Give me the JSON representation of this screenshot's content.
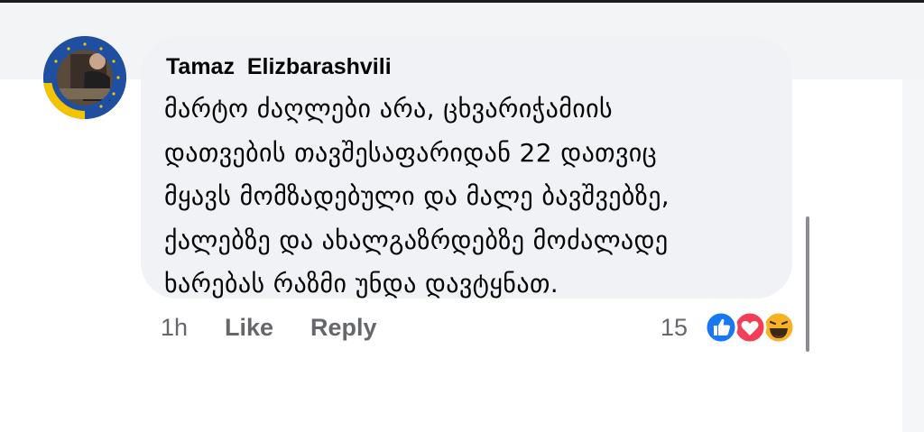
{
  "comment": {
    "author": "Tamaz  Elizbarashvili",
    "lines": [
      "მარტო ძაღლები არა, ცხვარიჭამიის",
      "დათვების თავშესაფარიდან 22 დათვიც",
      "მყავს მომზადებული და მალე ბავშვებზე,",
      "ქალებზე და ახალგაზრდებზე მოძალადე",
      "ხარებას რაზმი უნდა დავტყნათ."
    ],
    "time": "1h",
    "like_label": "Like",
    "reply_label": "Reply",
    "reaction_count": "15",
    "reactions": [
      "like-icon",
      "love-icon",
      "haha-icon"
    ]
  },
  "colors": {
    "bubble": "#f0f2f5",
    "like_blue": "#1877f2",
    "love_red": "#f33e58",
    "haha_yellow": "#f7b125",
    "meta_gray": "#65676b"
  }
}
